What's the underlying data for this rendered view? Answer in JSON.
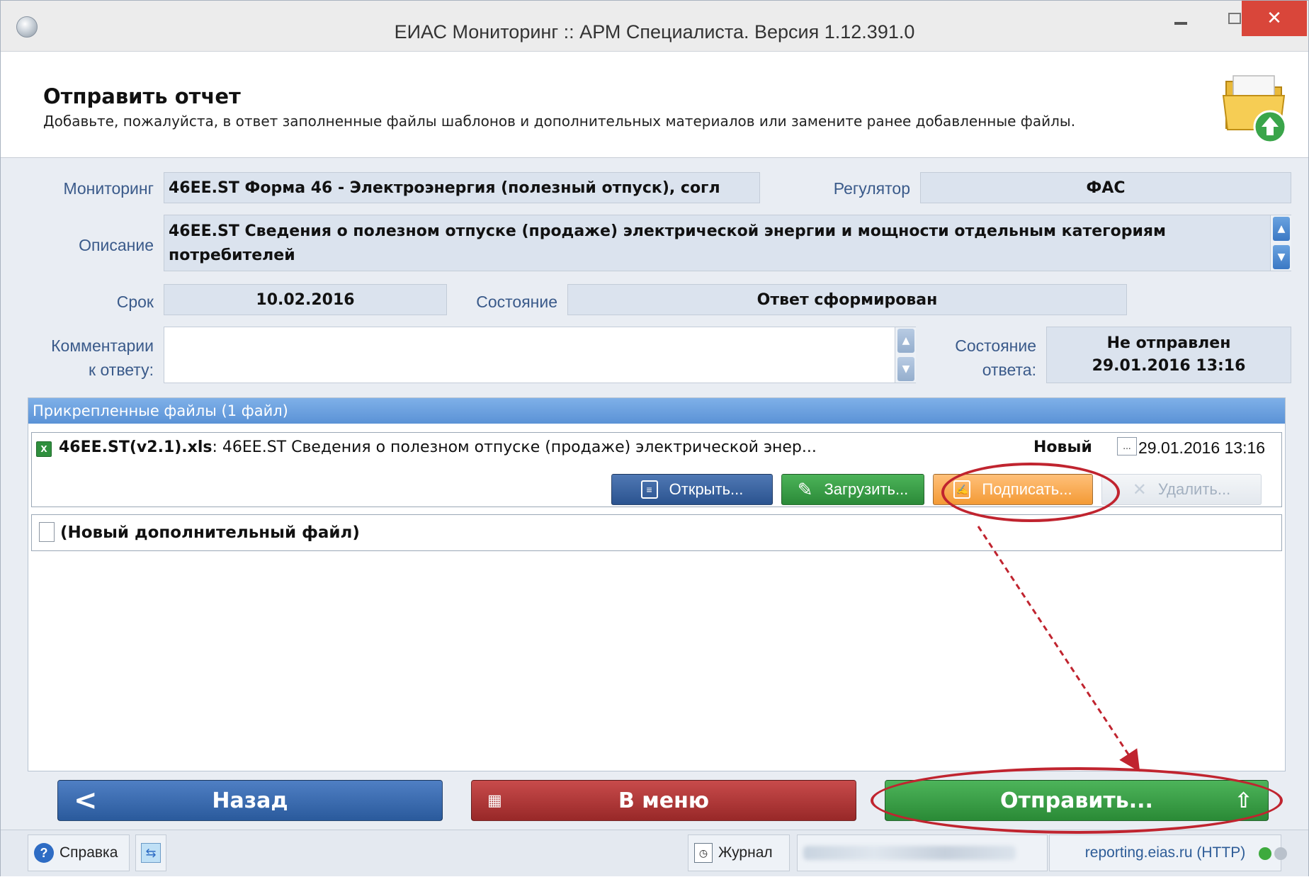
{
  "window": {
    "title": "ЕИАС Мониторинг :: АРМ Специалиста. Версия 1.12.391.0",
    "minimize_glyph": "–",
    "close_glyph": "✕"
  },
  "header": {
    "title": "Отправить отчет",
    "subtitle": "Добавьте, пожалуйста, в ответ заполненные файлы шаблонов и дополнительных материалов или замените ранее добавленные файлы.",
    "icon": "folder-upload-icon"
  },
  "form": {
    "monitoring_label": "Мониторинг",
    "monitoring_value": "46EE.ST  Форма 46 - Электроэнергия (полезный отпуск), согл",
    "regulator_label": "Регулятор",
    "regulator_value": "ФАС",
    "description_label": "Описание",
    "description_value": "46EE.ST  Сведения о полезном отпуске (продаже) электрической энергии и мощности отдельным категориям потребителей",
    "deadline_label": "Срок",
    "deadline_value": "10.02.2016",
    "state_label": "Состояние",
    "state_value": "Ответ сформирован",
    "comments_label_1": "Комментарии",
    "comments_label_2": "к ответу:",
    "comments_value": "",
    "answer_state_label_1": "Состояние",
    "answer_state_label_2": "ответа:",
    "answer_state_value_1": "Не отправлен",
    "answer_state_value_2": "29.01.2016 13:16"
  },
  "files": {
    "header": "Прикрепленные файлы (1 файл)",
    "items": [
      {
        "name": "46EE.ST(v2.1).xls",
        "description": ": 46EE.ST Сведения о полезном отпуске (продаже) электрической энер...",
        "status": "Новый",
        "checkbox_text": "...",
        "date": "29.01.2016 13:16",
        "icon": "excel-file-icon"
      }
    ],
    "buttons": {
      "open": "Открыть...",
      "load": "Загрузить...",
      "sign": "Подписать...",
      "delete": "Удалить..."
    },
    "new_file_label": "(Новый дополнительный файл)"
  },
  "bottom": {
    "back": "Назад",
    "menu": "В меню",
    "send": "Отправить..."
  },
  "statusbar": {
    "help": "Справка",
    "journal": "Журнал",
    "server": "reporting.eias.ru (HTTP)"
  },
  "colors": {
    "annotation": "#c0242f",
    "accent_blue": "#2a5a9c",
    "send_green": "#2a8a36",
    "menu_red": "#982828",
    "sign_orange": "#f39a35"
  }
}
